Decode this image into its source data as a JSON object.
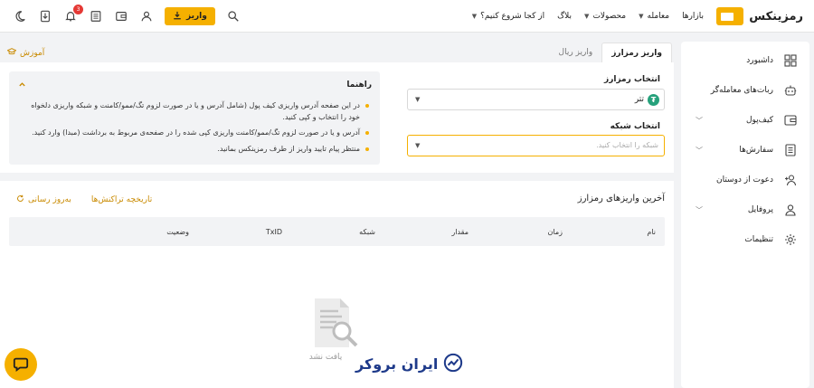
{
  "header": {
    "brand": "رمزینکس",
    "nav": [
      {
        "label": "بازارها",
        "has_menu": false
      },
      {
        "label": "معامله",
        "has_menu": true
      },
      {
        "label": "محصولات",
        "has_menu": true
      },
      {
        "label": "بلاگ",
        "has_menu": false
      },
      {
        "label": "از کجا شروع کنیم؟",
        "has_menu": true
      }
    ],
    "deposit_label": "واریز",
    "notification_count": "3"
  },
  "sidebar": {
    "items": [
      {
        "label": "داشبورد",
        "icon": "grid-icon",
        "has_menu": false
      },
      {
        "label": "ربات‌های معامله‌گر",
        "icon": "robot-icon",
        "has_menu": false
      },
      {
        "label": "کیف‌پول",
        "icon": "wallet-icon",
        "has_menu": true
      },
      {
        "label": "سفارش‌ها",
        "icon": "orders-icon",
        "has_menu": true
      },
      {
        "label": "دعوت از دوستان",
        "icon": "invite-icon",
        "has_menu": false
      },
      {
        "label": "پروفایل",
        "icon": "user-icon",
        "has_menu": true
      },
      {
        "label": "تنظیمات",
        "icon": "gear-icon",
        "has_menu": false
      }
    ]
  },
  "tabs": [
    {
      "label": "واریز رمزارز",
      "active": true
    },
    {
      "label": "واریز ریال",
      "active": false
    }
  ],
  "learn_label": "آموزش",
  "form": {
    "coin_label": "انتخاب رمزارز",
    "coin_value": "تتر",
    "network_label": "انتخاب شبکه",
    "network_placeholder": "شبکه را انتخاب کنید."
  },
  "guide": {
    "title": "راهنما",
    "items": [
      "در این صفحه آدرس واریزی کیف پول (شامل آدرس و یا در صورت لزوم تگ/ممو/کامنت و شبکه واریزی دلخواه خود را انتخاب و کپی کنید.",
      "آدرس و یا در صورت لزوم تگ/ممو/کامنت واریزی کپی شده را در صفحه‌ی مربوط به برداشت (مبدا) وارد کنید.",
      "منتظر پیام تایید واریز از طرف رمزینکس بمانید."
    ]
  },
  "history": {
    "title": "آخرین واریزهای رمزارز",
    "links": [
      "تاریخچه تراکنش‌ها",
      "به‌روز رسانی"
    ],
    "columns": [
      "نام",
      "زمان",
      "مقدار",
      "شبکه",
      "TxID",
      "وضعیت"
    ],
    "empty_text": "یافت نشد"
  },
  "watermark": "ایران بروکر",
  "colors": {
    "accent": "#f5b000",
    "badge": "#e53935",
    "tether": "#26a17b"
  }
}
